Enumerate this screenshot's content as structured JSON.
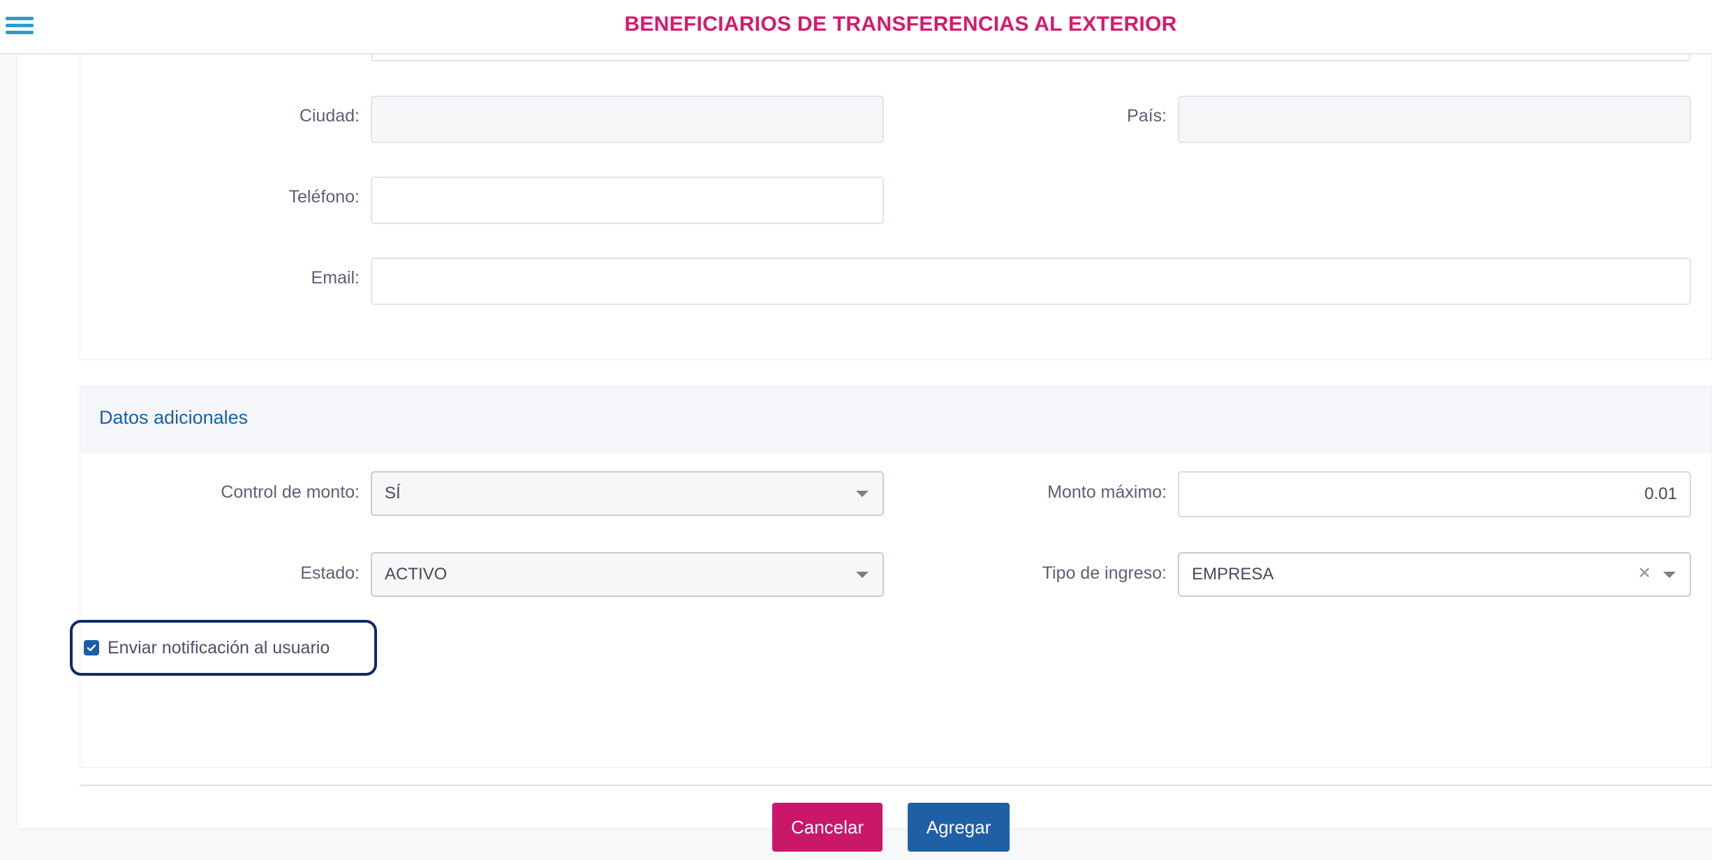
{
  "header": {
    "title": "BENEFICIARIOS DE TRANSFERENCIAS AL EXTERIOR",
    "menu_icon": "hamburger-menu-icon"
  },
  "contact": {
    "ciudad_label": "Ciudad:",
    "ciudad_value": "",
    "pais_label": "País:",
    "pais_value": "",
    "telefono_label": "Teléfono:",
    "telefono_value": "",
    "email_label": "Email:",
    "email_value": ""
  },
  "additional": {
    "section_title": "Datos adicionales",
    "control_monto_label": "Control de monto:",
    "control_monto_value": "SÍ",
    "monto_maximo_label": "Monto máximo:",
    "monto_maximo_value": "0.01",
    "estado_label": "Estado:",
    "estado_value": "ACTIVO",
    "tipo_ingreso_label": "Tipo de ingreso:",
    "tipo_ingreso_value": "EMPRESA",
    "tipo_ingreso_clear": "×",
    "notify_label": "Enviar notificación al usuario",
    "notify_checked": true
  },
  "actions": {
    "cancel_label": "Cancelar",
    "add_label": "Agregar"
  },
  "colors": {
    "title": "#d6196e",
    "menu_icon": "#2f9dcc",
    "section_title": "#1c5ea1",
    "cancel_button": "#c9176a",
    "add_button": "#1f5fa6",
    "focus_outline": "#0f2b63"
  }
}
